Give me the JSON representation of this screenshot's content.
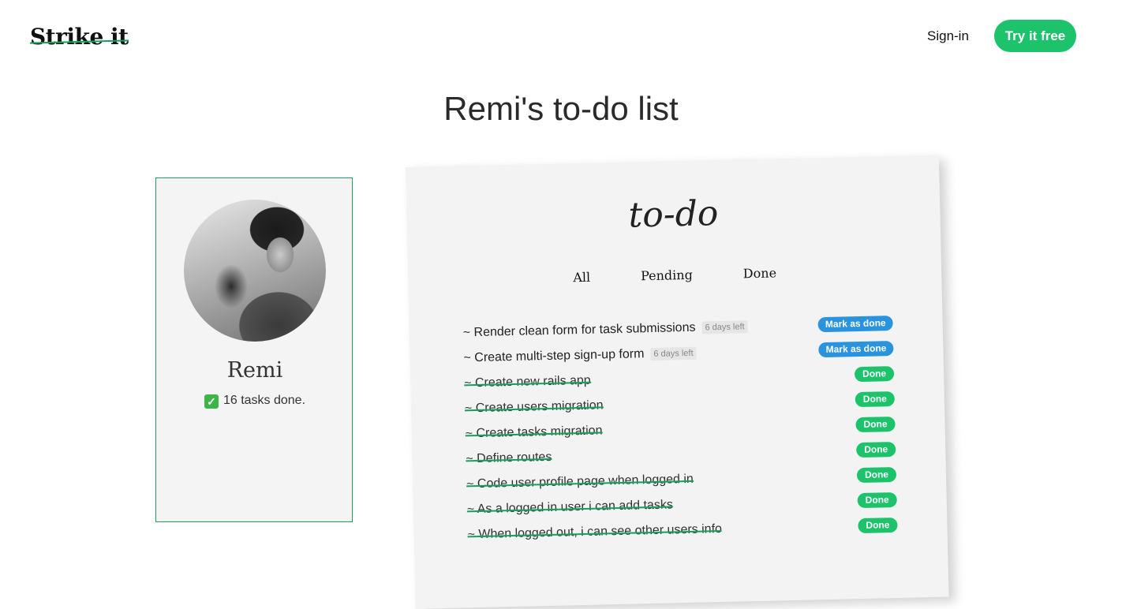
{
  "header": {
    "logo": "Strike it",
    "signin_label": "Sign-in",
    "cta_label": "Try it free",
    "accent_color": "#1dc36b"
  },
  "page": {
    "title": "Remi's to-do list"
  },
  "profile": {
    "name": "Remi",
    "stats": "16 tasks done.",
    "check_icon": "white-heavy-check-mark-icon"
  },
  "todo": {
    "heading": "to-do",
    "filters": [
      "All",
      "Pending",
      "Done"
    ],
    "tasks": [
      {
        "text": "~ Render clean form for task submissions",
        "deadline": "6 days left",
        "status": "pending",
        "action": "Mark as done"
      },
      {
        "text": "~ Create multi-step sign-up form",
        "deadline": "6 days left",
        "status": "pending",
        "action": "Mark as done"
      },
      {
        "text": "~ Create new rails app",
        "deadline": "",
        "status": "done",
        "action": "Done"
      },
      {
        "text": "~ Create users migration",
        "deadline": "",
        "status": "done",
        "action": "Done"
      },
      {
        "text": "~ Create tasks migration",
        "deadline": "",
        "status": "done",
        "action": "Done"
      },
      {
        "text": "~ Define routes",
        "deadline": "",
        "status": "done",
        "action": "Done"
      },
      {
        "text": "~ Code user profile page when logged in",
        "deadline": "",
        "status": "done",
        "action": "Done"
      },
      {
        "text": "~ As a logged in user i can add tasks",
        "deadline": "",
        "status": "done",
        "action": "Done"
      },
      {
        "text": "~ When logged out, i can see other users info",
        "deadline": "",
        "status": "done",
        "action": "Done"
      }
    ]
  }
}
